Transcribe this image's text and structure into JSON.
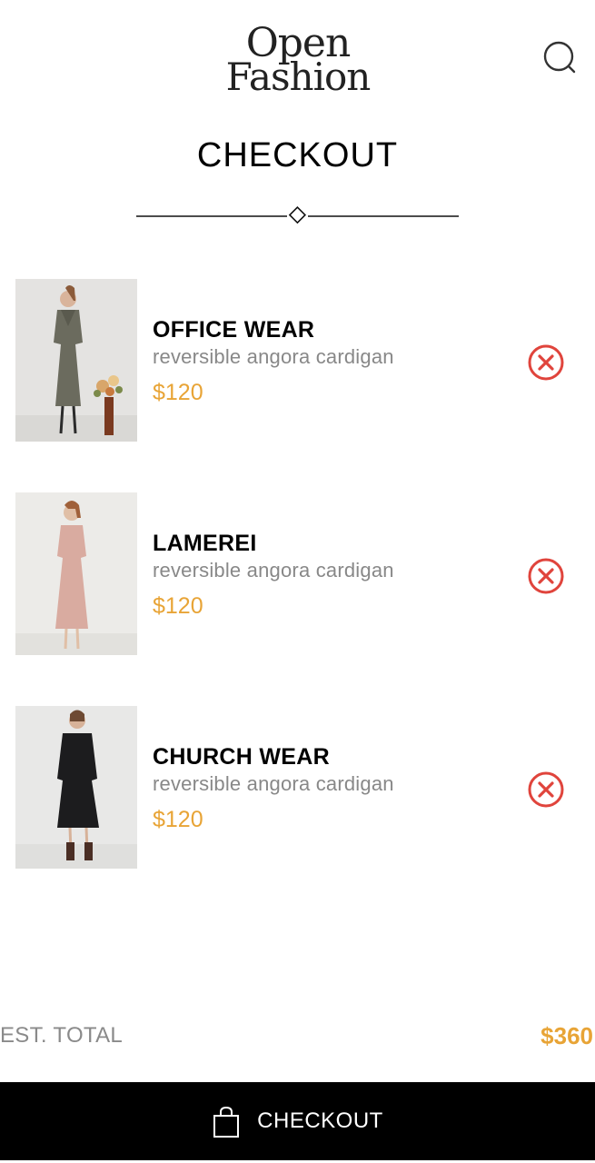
{
  "header": {
    "logo_line1": "Open",
    "logo_line2": "Fashion",
    "search_icon": "search-icon"
  },
  "page": {
    "title": "CHECKOUT"
  },
  "cart": {
    "items": [
      {
        "name": "OFFICE WEAR",
        "description": "reversible angora cardigan",
        "price": "$120",
        "image": "office-wear-photo",
        "remove_icon": "remove-circle-x-icon"
      },
      {
        "name": "LAMEREI",
        "description": "reversible angora cardigan",
        "price": "$120",
        "image": "lamerei-photo",
        "remove_icon": "remove-circle-x-icon"
      },
      {
        "name": "CHURCH WEAR",
        "description": "reversible angora cardigan",
        "price": "$120",
        "image": "church-wear-photo",
        "remove_icon": "remove-circle-x-icon"
      }
    ]
  },
  "summary": {
    "total_label": "EST. TOTAL",
    "total_value": "$360"
  },
  "checkout_button": {
    "label": "CHECKOUT",
    "icon": "shopping-bag-icon"
  },
  "colors": {
    "accent": "#e8a436",
    "remove": "#e0443c",
    "muted_text": "#888888",
    "bar_background": "#000000"
  }
}
